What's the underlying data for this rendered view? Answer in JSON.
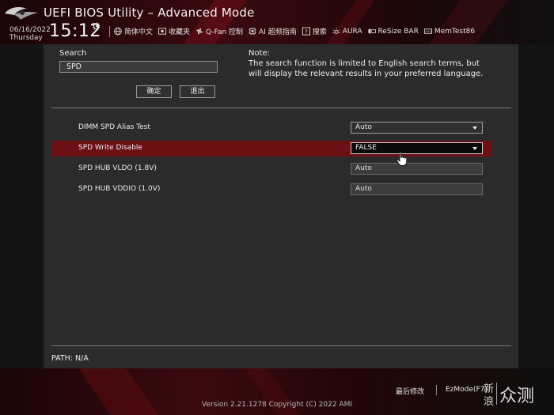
{
  "header": {
    "title": "UEFI BIOS Utility – Advanced Mode",
    "date": "06/16/2022",
    "day": "Thursday",
    "time": "15:12",
    "toolbar": [
      {
        "icon": "globe-icon",
        "label": "简体中文"
      },
      {
        "icon": "favorites-icon",
        "label": "收藏夹"
      },
      {
        "icon": "fan-icon",
        "label": "Q-Fan 控制"
      },
      {
        "icon": "ai-overclock-icon",
        "label": "AI 超频指南"
      },
      {
        "icon": "help-icon",
        "label": "搜索"
      },
      {
        "icon": "aura-icon",
        "label": "AURA"
      },
      {
        "icon": "resize-bar-icon",
        "label": "ReSize BAR"
      },
      {
        "icon": "memtest-icon",
        "label": "MemTest86"
      }
    ]
  },
  "search": {
    "label": "Search",
    "value": "SPD",
    "ok_label": "确定",
    "exit_label": "退出"
  },
  "note": {
    "title": "Note:",
    "text": "The search function is limited to English search terms, but will display the relevant results in your preferred language."
  },
  "settings": [
    {
      "label": "DIMM SPD Alias Test",
      "value": "Auto",
      "type": "select"
    },
    {
      "label": "SPD Write Disable",
      "value": "FALSE",
      "type": "select",
      "highlighted": true
    },
    {
      "label": "SPD HUB VLDO (1.8V)",
      "value": "Auto",
      "type": "field"
    },
    {
      "label": "SPD HUB VDDIO (1.0V)",
      "value": "Auto",
      "type": "field"
    }
  ],
  "path": "PATH: N/A",
  "footer": {
    "last_modified": "最后修改",
    "ezmode": "EzMode(F7)",
    "version": "Version 2.21.1278 Copyright (C) 2022 AMI",
    "watermark": "新浪众测"
  },
  "colors": {
    "accent": "#6d1016",
    "panel": "#2b2b2b",
    "background": "#141414"
  }
}
